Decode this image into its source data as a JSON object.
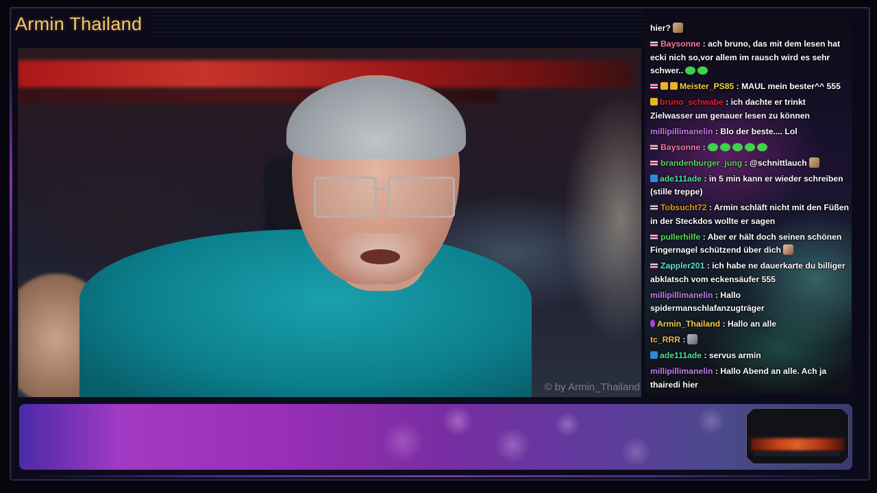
{
  "channel": {
    "title": "Armin Thailand"
  },
  "webcam": {
    "watermark": "© by Armin_Thailand"
  },
  "chat": {
    "messages": [
      {
        "user": "",
        "user_color": "#ffffff",
        "text": "hier?",
        "emotes": [
          "image-emote"
        ]
      },
      {
        "user": "Baysonne",
        "user_color": "#ff7aa6",
        "text": " : ach bruno, das mit dem lesen hat ecki nich so,vor allem im rausch wird es sehr schwer..",
        "emotes": [
          "green-emote",
          "green-emote"
        ]
      },
      {
        "user": "Meister_PS85",
        "user_color": "#f5d14a",
        "text": " : MAUL mein bester^^ 555",
        "emotes": []
      },
      {
        "user": "bruno_schwabe",
        "user_color": "#e0242c",
        "text": " : ich dachte er trinkt Zielwasser um genauer lesen zu können",
        "emotes": []
      },
      {
        "user": "millipillimanelin",
        "user_color": "#c67cf2",
        "text": " : Blo der beste.... Lol",
        "emotes": []
      },
      {
        "user": "Baysonne",
        "user_color": "#ff7aa6",
        "text": " :",
        "emotes": [
          "green-emote",
          "green-emote",
          "green-emote",
          "green-emote",
          "green-emote"
        ]
      },
      {
        "user": "brandenburger_jung",
        "user_color": "#5fd15f",
        "text": " : @schnittlauch",
        "emotes": [
          "image-emote"
        ]
      },
      {
        "user": "ade111ade",
        "user_color": "#4ee0a0",
        "text": " : in 5 min kann er wieder schreiben (stille treppe)",
        "emotes": []
      },
      {
        "user": "Tobsucht72",
        "user_color": "#e29a1e",
        "text": " : Armin schläft nicht mit den Füßen in der Steckdos wollte er sagen",
        "emotes": []
      },
      {
        "user": "pullerhilfe",
        "user_color": "#57df57",
        "text": " : Aber er hält doch seinen schönen Fingernagel schützend über dich",
        "emotes": [
          "face-emote"
        ]
      },
      {
        "user": "Zappler201",
        "user_color": "#5fe3d6",
        "text": " : ich habe ne dauerkarte du billiger abklatsch vom eckensäufer 555",
        "emotes": []
      },
      {
        "user": "millipillimanelin",
        "user_color": "#c67cf2",
        "text": " : Hallo spidermanschlafanzugträger",
        "emotes": []
      },
      {
        "user": "Armin_Thailand",
        "user_color": "#f5d14a",
        "text": " : Hallo an alle",
        "emotes": []
      },
      {
        "user": "tc_RRR",
        "user_color": "#f5b64a",
        "text": " :",
        "emotes": [
          "gray-emote"
        ]
      },
      {
        "user": "ade111ade",
        "user_color": "#4ee0a0",
        "text": " : servus armin",
        "emotes": []
      },
      {
        "user": "millipillimanelin",
        "user_color": "#c67cf2",
        "text": " : Hallo Abend an alle. Ach ja thairedi hier",
        "emotes": []
      }
    ]
  },
  "colors": {
    "accent": "#f7c66a",
    "banner_start": "#4a2aa8",
    "banner_mid": "#a23ac4"
  }
}
